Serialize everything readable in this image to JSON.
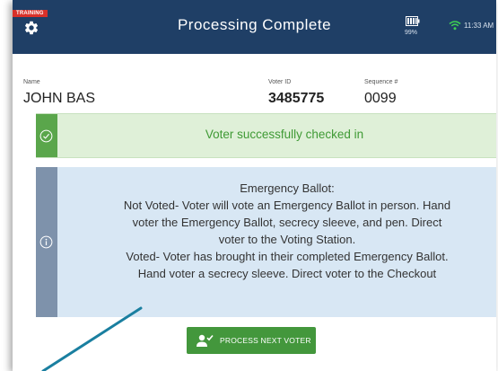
{
  "header": {
    "training_badge": "TRAINING",
    "title": "Processing Complete",
    "battery_pct": "99%",
    "time": "11:33 AM"
  },
  "voter": {
    "name_label": "Name",
    "name_value": "JOHN BAS",
    "id_label": "Voter ID",
    "id_value": "3485775",
    "seq_label": "Sequence #",
    "seq_value": "0099"
  },
  "success_alert": {
    "icon": "check-circle-icon",
    "text": "Voter successfully checked in"
  },
  "info_alert": {
    "icon": "info-circle-icon",
    "lines": [
      "Emergency Ballot:",
      "Not Voted- Voter will vote an Emergency Ballot in person. Hand",
      "voter the Emergency Ballot, secrecy sleeve, and pen. Direct",
      "voter to the Voting Station.",
      "Voted- Voter has brought in their completed Emergency Ballot.",
      "Hand voter a secrecy sleeve. Direct voter to the Checkout"
    ]
  },
  "actions": {
    "next_icon": "person-check-icon",
    "next_label": "PROCESS NEXT VOTER"
  },
  "colors": {
    "header_bg": "#1f3f66",
    "training_red": "#d8312a",
    "success_green": "#5aa64b",
    "success_bg": "#dff0d8",
    "info_bg": "#d8e7f4",
    "info_bar": "#7e92ab",
    "button_green": "#43973c",
    "annotation_line": "#1a7fa0"
  }
}
